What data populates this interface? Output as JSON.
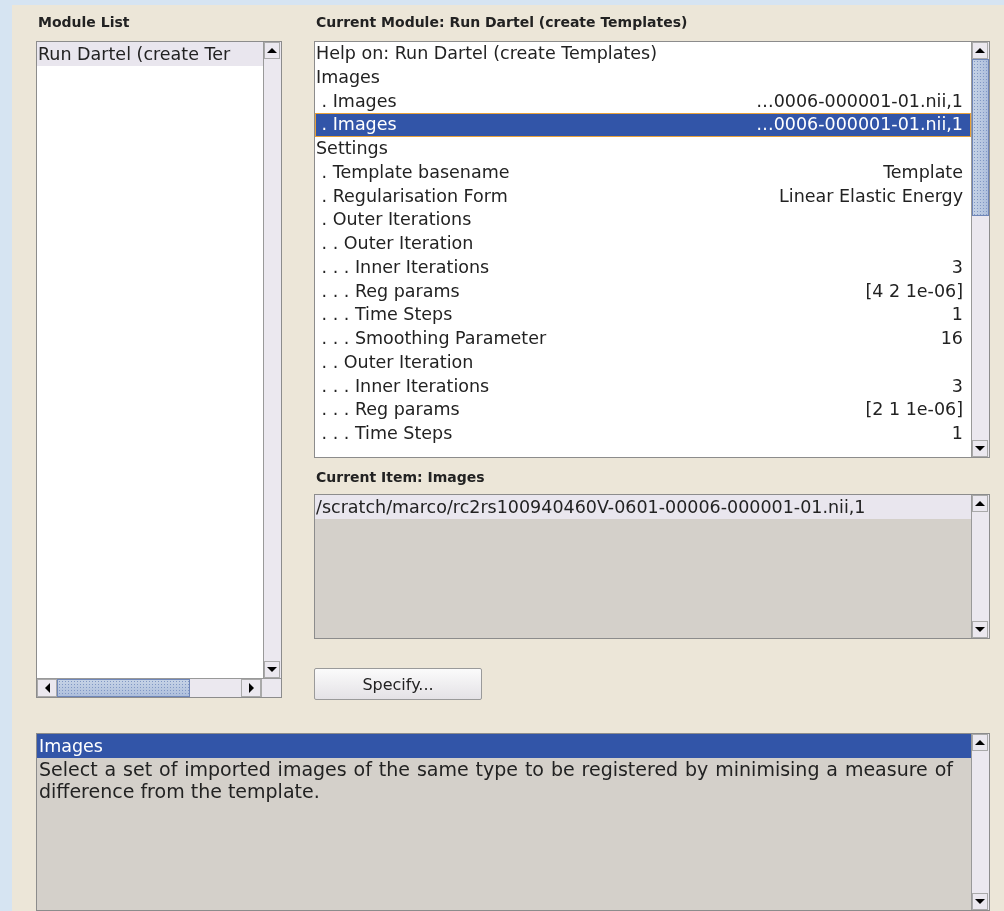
{
  "module_list": {
    "title": "Module List",
    "items": [
      {
        "label": "Run Dartel (create Ter",
        "selected": true
      }
    ]
  },
  "current_module": {
    "title": "Current Module: Run Dartel (create Templates)",
    "rows": [
      {
        "label": "Help on: Run Dartel (create Templates)",
        "selected": false
      },
      {
        "label": "Images",
        "selected": false
      },
      {
        "label": " . Images",
        "value": "…0006-000001-01.nii,1",
        "selected": false
      },
      {
        "label": " . Images",
        "value": "…0006-000001-01.nii,1",
        "selected": true
      },
      {
        "label": "Settings",
        "selected": false
      },
      {
        "label": " . Template basename",
        "value": "Template",
        "selected": false
      },
      {
        "label": " . Regularisation Form",
        "value": "Linear Elastic Energy",
        "selected": false
      },
      {
        "label": " . Outer Iterations",
        "selected": false
      },
      {
        "label": " . . Outer Iteration",
        "selected": false
      },
      {
        "label": " . . . Inner Iterations",
        "value": "3",
        "selected": false
      },
      {
        "label": " . . . Reg params",
        "value": "[4 2 1e-06]",
        "selected": false
      },
      {
        "label": " . . . Time Steps",
        "value": "1",
        "selected": false
      },
      {
        "label": " . . . Smoothing Parameter",
        "value": "16",
        "selected": false
      },
      {
        "label": " . . Outer Iteration",
        "selected": false
      },
      {
        "label": " . . . Inner Iterations",
        "value": "3",
        "selected": false
      },
      {
        "label": " . . . Reg params",
        "value": "[2 1 1e-06]",
        "selected": false
      },
      {
        "label": " . . . Time Steps",
        "value": "1",
        "selected": false
      }
    ]
  },
  "current_item": {
    "title": "Current Item: Images",
    "lines": [
      {
        "text": "/scratch/marco/rc2rs100940460V-0601-00006-000001-01.nii,1",
        "selected": true
      }
    ]
  },
  "specify_button": {
    "label": "Specify..."
  },
  "help": {
    "title": "Images",
    "text": "Select a set of imported images of the same type to be registered by minimising a measure of difference from the template."
  }
}
